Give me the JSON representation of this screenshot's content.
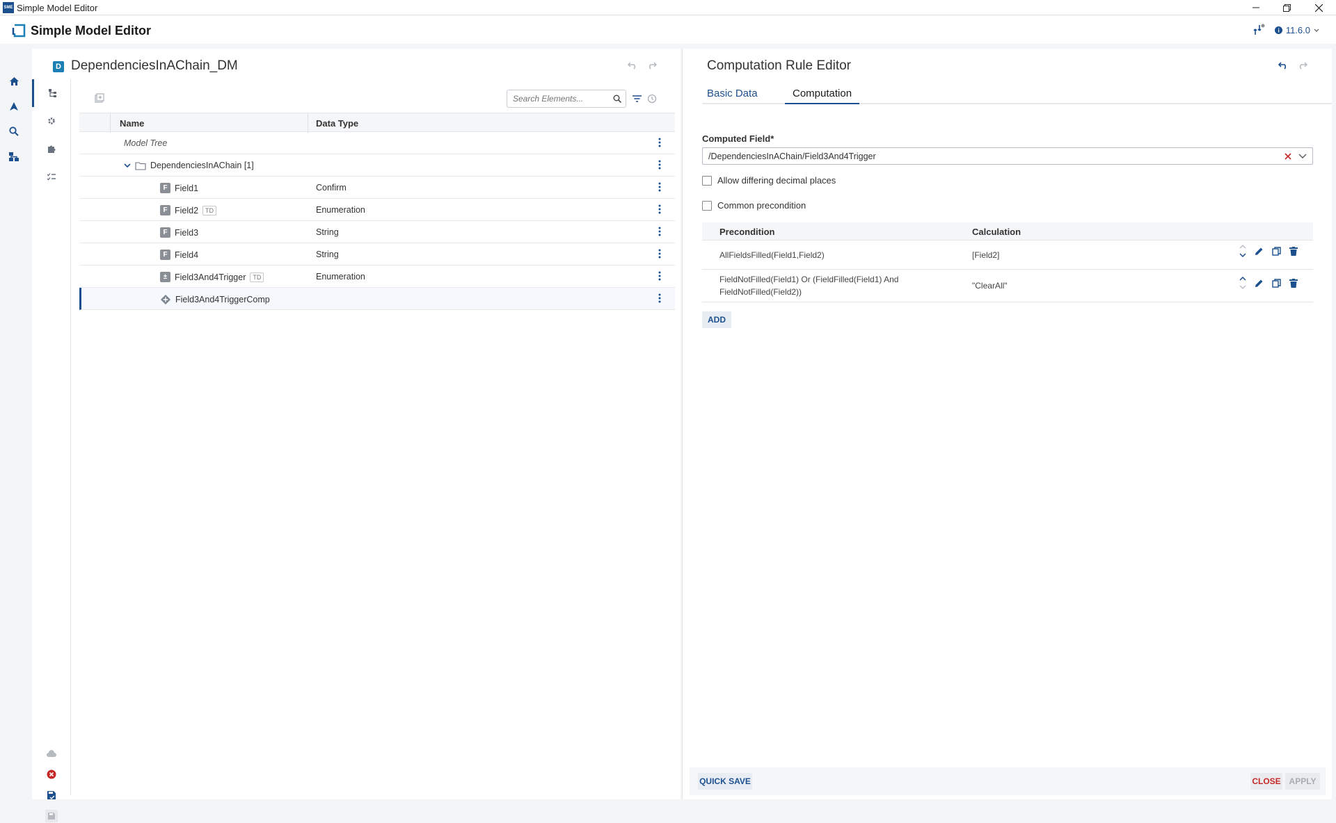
{
  "window": {
    "title": "Simple Model Editor",
    "app_icon_text": "SME"
  },
  "header": {
    "app_name": "Simple Model Editor",
    "version": "11.6.0"
  },
  "left_panel": {
    "title": "DependenciesInAChain_DM",
    "badge": "D",
    "search_placeholder": "Search Elements...",
    "columns": {
      "name": "Name",
      "type": "Data Type"
    },
    "rows": [
      {
        "name": "Model Tree",
        "type": "",
        "kind": "root"
      },
      {
        "name": "DependenciesInAChain [1]",
        "type": "",
        "kind": "folder"
      },
      {
        "name": "Field1",
        "type": "Confirm",
        "kind": "field",
        "icon": "F"
      },
      {
        "name": "Field2",
        "type": "Enumeration",
        "kind": "field",
        "icon": "F",
        "badge": "TD"
      },
      {
        "name": "Field3",
        "type": "String",
        "kind": "field",
        "icon": "F"
      },
      {
        "name": "Field4",
        "type": "String",
        "kind": "field",
        "icon": "F"
      },
      {
        "name": "Field3And4Trigger",
        "type": "Enumeration",
        "kind": "field",
        "icon": "±",
        "badge": "TD"
      },
      {
        "name": "Field3And4TriggerComp",
        "type": "",
        "kind": "computation"
      }
    ]
  },
  "right_panel": {
    "title": "Computation Rule Editor",
    "tabs": [
      "Basic Data",
      "Computation"
    ],
    "active_tab": "Computation",
    "computed_field_label": "Computed Field*",
    "computed_field_value": "/DependenciesInAChain/Field3And4Trigger",
    "checkbox_decimal": "Allow differing decimal places",
    "checkbox_common": "Common precondition",
    "rules_columns": {
      "precondition": "Precondition",
      "calculation": "Calculation"
    },
    "rules": [
      {
        "precondition": "AllFieldsFilled(Field1,Field2)",
        "calculation": "[Field2]"
      },
      {
        "precondition": "FieldNotFilled(Field1) Or (FieldFilled(Field1) And FieldNotFilled(Field2))",
        "calculation": "\"ClearAll\""
      }
    ],
    "add_label": "ADD",
    "quick_save_label": "QUICK SAVE",
    "close_label": "CLOSE",
    "apply_label": "APPLY"
  },
  "colors": {
    "accent": "#1c4f8e",
    "danger": "#c62828",
    "icon_blue": "#1a7fb4"
  }
}
